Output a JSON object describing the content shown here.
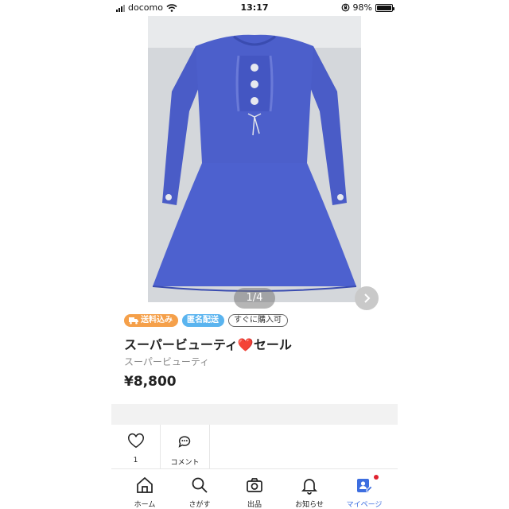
{
  "status_bar": {
    "carrier": "docomo",
    "time": "13:17",
    "battery": "98%",
    "battery_level": 0.98
  },
  "gallery": {
    "counter": "1/4"
  },
  "item": {
    "badges": [
      {
        "label": "送料込み",
        "color": "#f5a04a",
        "icon": "truck-icon"
      },
      {
        "label": "匿名配送",
        "color": "#5ab4ef"
      },
      {
        "label": "すぐに購入可",
        "color": "#ffffff"
      }
    ],
    "title_text": "スーパービューティ",
    "title_emoji": "❤️",
    "title_suffix": "セール",
    "brand": "スーパービューティ",
    "price": "¥8,800"
  },
  "actions": {
    "like_count": "1",
    "comment_label": "コメント"
  },
  "nav": {
    "items": [
      {
        "label": "ホーム",
        "icon": "home-icon"
      },
      {
        "label": "さがす",
        "icon": "search-icon"
      },
      {
        "label": "出品",
        "icon": "camera-icon"
      },
      {
        "label": "お知らせ",
        "icon": "bell-icon"
      },
      {
        "label": "マイページ",
        "icon": "mypage-icon",
        "active": true
      }
    ],
    "active_color": "#3d6ee0"
  }
}
